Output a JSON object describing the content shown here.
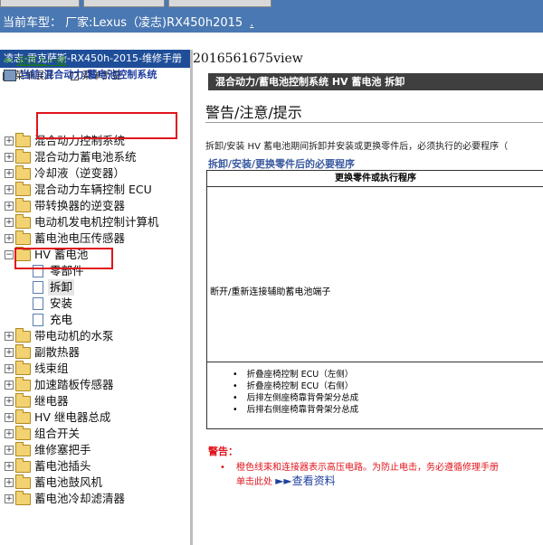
{
  "top": {
    "vehicle_label": "当前车型：  厂家:Lexus（凌志)RX450h2015",
    "vehicle_link": "."
  },
  "left": {
    "header": "凌志-雷克萨斯-RX450h-2015-维修手册",
    "expand": "菜单展开",
    "collapse": "菜单折叠",
    "back": "返回上一级",
    "current": "当前:混合动力/蓄电池控制系统",
    "tree": [
      "混合动力控制系统",
      "混合动力蓄电池系统",
      "冷却液（逆变器）",
      "混合动力车辆控制 ECU",
      "带转换器的逆变器",
      "电动机发电机控制计算机",
      "蓄电池电压传感器",
      "HV 蓄电池"
    ],
    "children": [
      "零部件",
      "拆卸",
      "安装",
      "充电"
    ],
    "tree2": [
      "带电动机的水泵",
      "副散热器",
      "线束组",
      "加速踏板传感器",
      "继电器",
      "HV 继电器总成",
      "组合开关",
      "维修塞把手",
      "蓄电池插头",
      "蓄电池鼓风机",
      "蓄电池冷却滤清器"
    ]
  },
  "right": {
    "doc_id": "2016561675view",
    "title": "混合动力/蓄电池控制系统  HV 蓄电池  拆卸",
    "warning_heading": "警告/注意/提示",
    "para": "拆卸/安装 HV 蓄电池期间拆卸并安装或更换零件后，必须执行的必要程序（",
    "sub_heading": "拆卸/安装/更换零件后的必要程序",
    "table_header": "更换零件或执行程序",
    "table_cell": "断开/重新连接辅助蓄电池端子",
    "list": [
      "折叠座椅控制 ECU（左侧）",
      "折叠座椅控制 ECU（右侧）",
      "后排左侧座椅靠背骨架分总成",
      "后排右侧座椅靠背骨架分总成"
    ],
    "warning_label": "警告：",
    "warning_bullet": "•",
    "warning_line1": "橙色线束和连接器表示高压电路。为防止电击，务必遵循修理手册",
    "warning_line2_prefix": "单击此处 ",
    "warning_more": "►►查看资料"
  }
}
